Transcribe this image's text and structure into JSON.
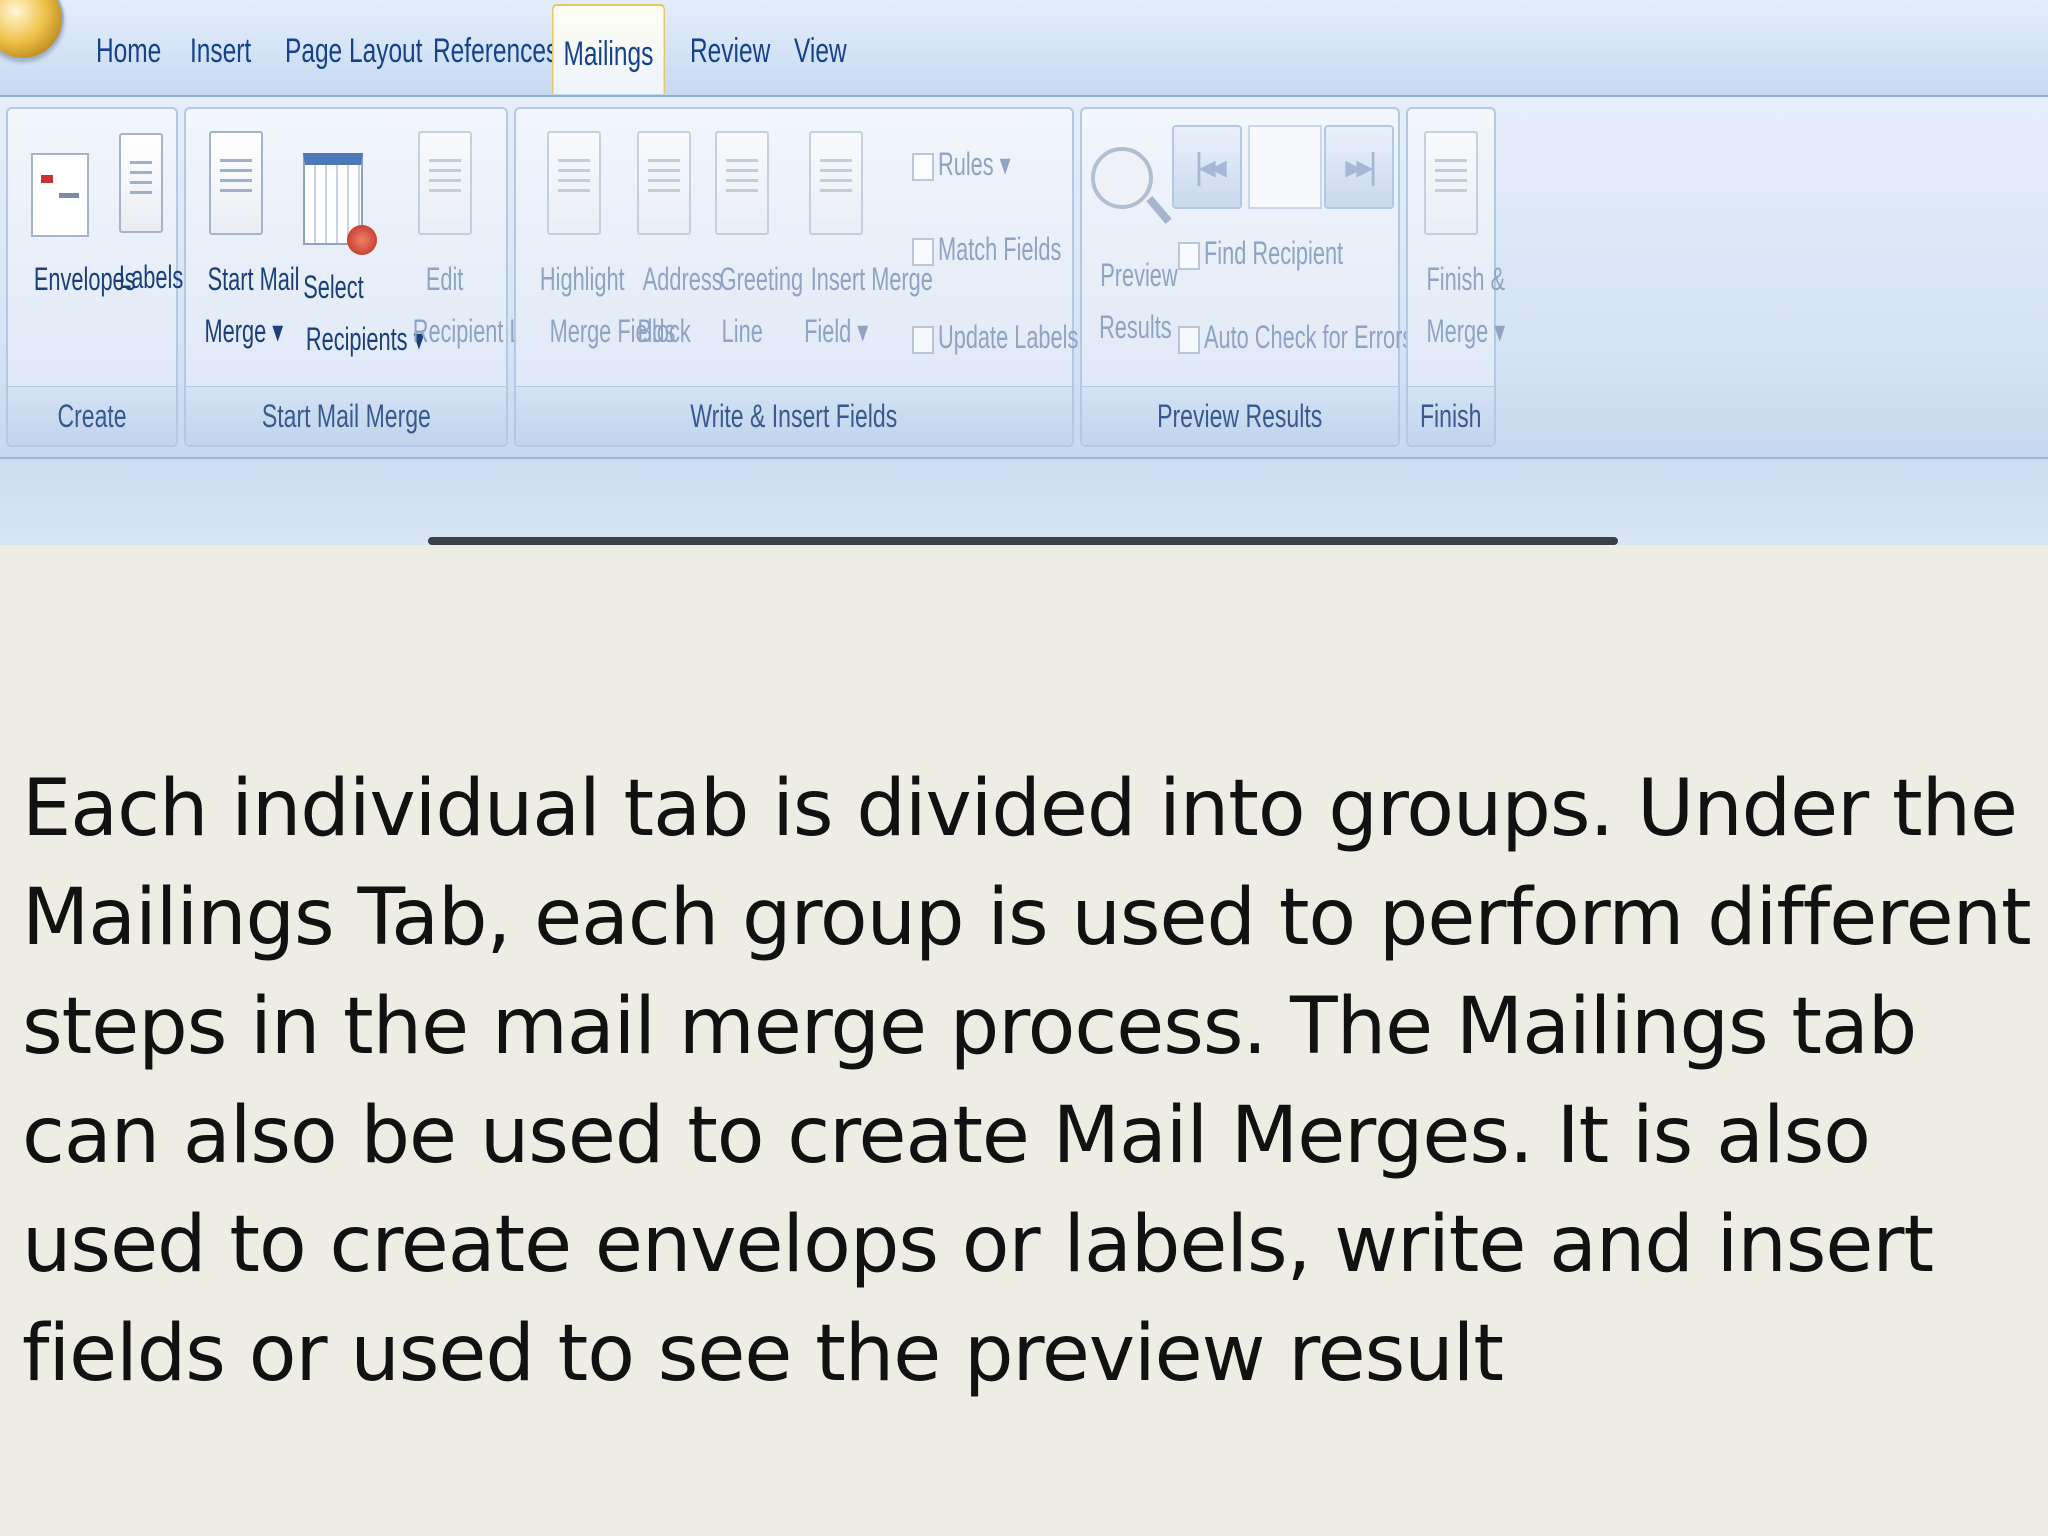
{
  "tabs": [
    "Home",
    "Insert",
    "Page Layout",
    "References",
    "Mailings",
    "Review",
    "View"
  ],
  "active_tab": "Mailings",
  "groups": {
    "create": {
      "label": "Create",
      "envelopes": "Envelopes",
      "labels": "Labels"
    },
    "start_mail_merge": {
      "label": "Start Mail Merge",
      "start_mail_merge_1": "Start Mail",
      "start_mail_merge_2": "Merge ▾",
      "select_recipients_1": "Select",
      "select_recipients_2": "Recipients ▾",
      "edit_recipient_list_1": "Edit",
      "edit_recipient_list_2": "Recipient List"
    },
    "write_insert": {
      "label": "Write & Insert Fields",
      "highlight_1": "Highlight",
      "highlight_2": "Merge Fields",
      "address_1": "Address",
      "address_2": "Block",
      "greeting_1": "Greeting",
      "greeting_2": "Line",
      "insert_merge_1": "Insert Merge",
      "insert_merge_2": "Field ▾",
      "rules": "Rules ▾",
      "match_fields": "Match Fields",
      "update_labels": "Update Labels"
    },
    "preview": {
      "label": "Preview Results",
      "preview_results_1": "Preview",
      "preview_results_2": "Results",
      "find_recipient": "Find Recipient",
      "auto_check": "Auto Check for Errors"
    },
    "finish": {
      "label": "Finish",
      "finish_merge_1": "Finish &",
      "finish_merge_2": "Merge ▾"
    }
  },
  "paragraph": "Each individual tab is divided into groups. Under the Mailings Tab, each group is used to perform different steps in the mail merge process. The Mailings tab can also be used to create Mail Merges. It is also used to create envelops or labels, write and insert fields or used to see the preview result"
}
